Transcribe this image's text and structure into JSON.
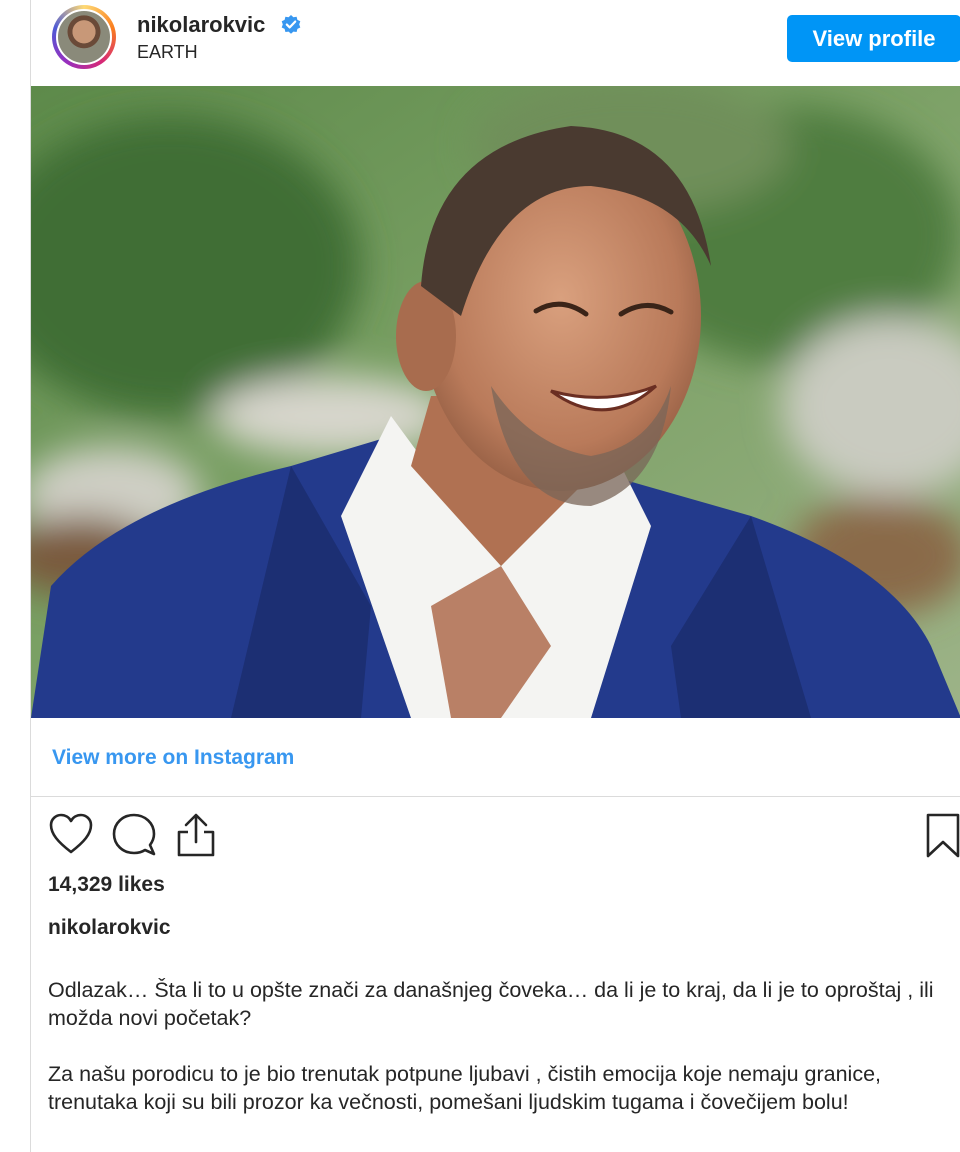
{
  "header": {
    "username": "nikolarokvic",
    "verified": true,
    "location": "EARTH",
    "view_profile_label": "View profile"
  },
  "post": {
    "image_alt": "Smiling man in a blue blazer and white shirt outdoors",
    "view_more_label": "View more on Instagram",
    "likes": "14,329 likes",
    "caption_username": "nikolarokvic",
    "caption_paragraphs": [
      "Odlazak… Šta li to u opšte znači za današnjeg čoveka… da li je to kraj, da li je to oproštaj , ili možda novi početak?",
      "Za našu porodicu to je bio trenutak potpune ljubavi , čistih emocija koje nemaju granice, trenutaka koji su bili prozor ka večnosti, pomešani ljudskim tugama i čovečijem bolu!"
    ]
  },
  "icons": [
    "heart-icon",
    "comment-icon",
    "share-icon",
    "bookmark-icon",
    "verified-icon"
  ],
  "colors": {
    "accent": "#0095f6",
    "link": "#3897f0",
    "verified": "#3897f0",
    "text": "#262626",
    "blazer": "#233a8c"
  }
}
